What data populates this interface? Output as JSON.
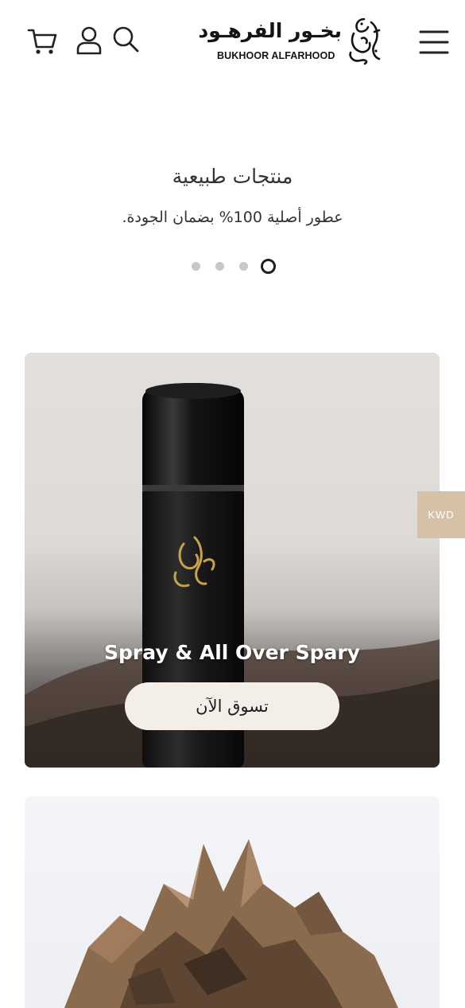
{
  "header": {
    "logo_ar": "بخـور الفرهـود",
    "logo_en": "BUKHOOR ALFARHOOD",
    "icons": [
      "cart-icon",
      "user-icon",
      "search-icon",
      "menu-icon"
    ]
  },
  "hero": {
    "title": "منتجات طبيعية",
    "subtitle": "عطور أصلية 100% بضمان الجودة.",
    "slides": 4,
    "active_slide": 4
  },
  "cards": [
    {
      "title": "Spray & All Over Spary",
      "button": "تسوق الآن"
    },
    {
      "title": ""
    }
  ],
  "currency": {
    "label": "KWD",
    "color": "#d5c1a6"
  },
  "colors": {
    "button_bg": "#f3efe8",
    "text": "#2b2b2b"
  }
}
